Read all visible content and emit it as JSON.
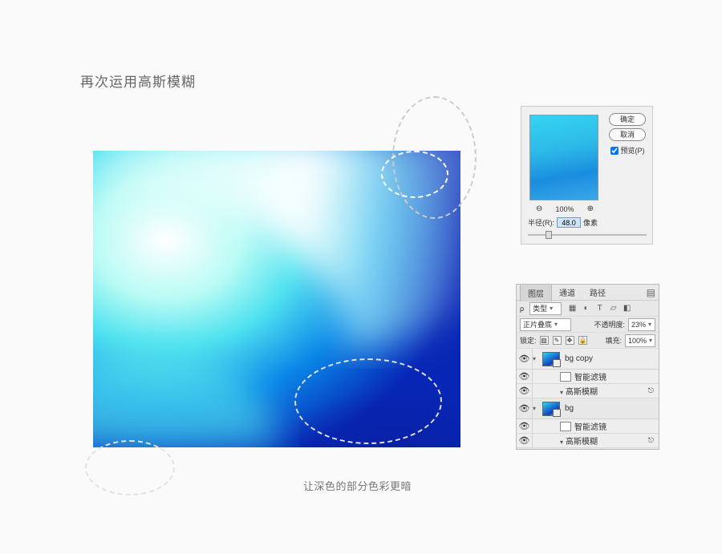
{
  "title": "再次运用高斯模糊",
  "caption": "让深色的部分色彩更暗",
  "dlg": {
    "ok": "确定",
    "cancel": "取消",
    "preview": "预览(P)",
    "zoom_out": "⊖",
    "zoom_pct": "100%",
    "zoom_in": "⊕",
    "radius_label": "半径(R):",
    "radius_value": "48.0",
    "radius_unit": "像素"
  },
  "panel": {
    "tabs": [
      "图层",
      "通道",
      "路径"
    ],
    "active_tab": 0,
    "kind_label": "类型",
    "blend_mode": "正片叠底",
    "opacity_label": "不透明度:",
    "opacity_value": "23%",
    "lock_label": "锁定:",
    "fill_label": "填充:",
    "fill_value": "100%",
    "layers": [
      {
        "name": "bg copy",
        "smart_filters_label": "智能滤镜",
        "filter_name": "高斯模糊"
      },
      {
        "name": "bg",
        "smart_filters_label": "智能滤镜",
        "filter_name": "高斯模糊"
      }
    ]
  }
}
